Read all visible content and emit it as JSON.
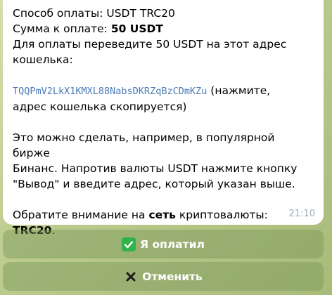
{
  "message": {
    "line1": "Способ оплаты: USDT TRC20",
    "line2_prefix": "Сумма к оплате: ",
    "line2_amount": "50 USDT",
    "line3": "Для оплаты переведите 50 USDT на этот адрес",
    "line4": "кошелька:",
    "wallet_address": "TQQPmV2LkX1KMXL88NabsDKRZqBzCDmKZu",
    "wallet_hint_part1": " (нажмите,",
    "wallet_hint_part2": "адрес кошелька скопируется)",
    "para2_line1": "Это можно сделать, например, в популярной бирже",
    "para2_line2": "Бинанс. Напротив валюты USDT нажмите кнопку",
    "para2_line3": "\"Вывод\" и введите адрес, который указан выше.",
    "note_prefix": "Обратите внимание на ",
    "note_bold1": "сеть",
    "note_middle": " криптовалюты: ",
    "note_bold2": "TRC20",
    "note_suffix": ".",
    "time": "21:10"
  },
  "buttons": {
    "paid_label": "Я оплатил",
    "cancel_label": "Отменить"
  },
  "icons": {
    "paid": "check-mark-icon",
    "cancel": "cross-icon"
  },
  "colors": {
    "link": "#4a7bb5",
    "timestamp": "#a0acb6",
    "check_bg": "#2fb34a"
  }
}
